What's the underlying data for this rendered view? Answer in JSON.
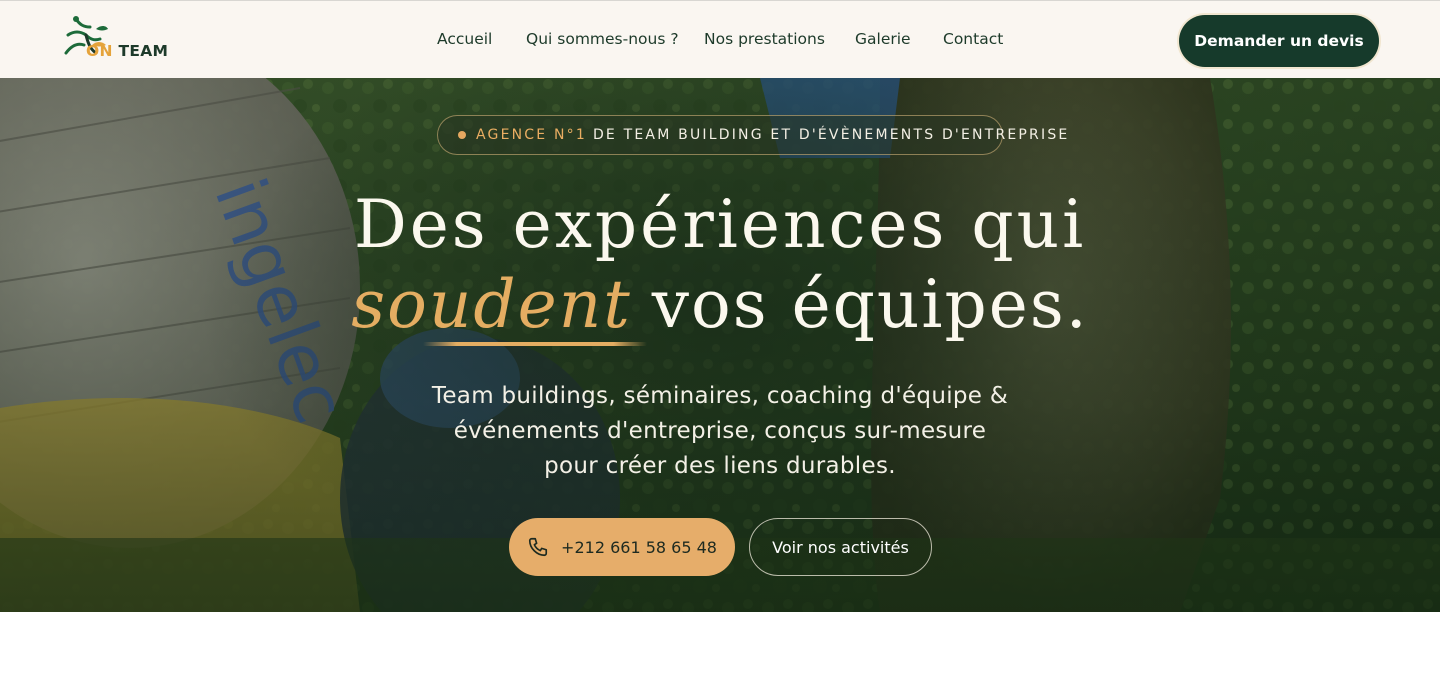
{
  "logo": {
    "text_on": "ON",
    "text_team": " TEAM",
    "icon": "leaf-runner-icon"
  },
  "nav": {
    "items": [
      {
        "label": "Accueil"
      },
      {
        "label": "Qui sommes-nous ?"
      },
      {
        "label": "Nos prestations"
      },
      {
        "label": "Galerie"
      },
      {
        "label": "Contact"
      }
    ]
  },
  "cta": {
    "label": "Demander un devis"
  },
  "hero": {
    "badge_accent": "AGENCE N°1",
    "badge_text": "DE TEAM BUILDING ET D'ÉVÈNEMENTS D'ENTREPRISE",
    "title_line1": "Des expériences qui",
    "title_script": "soudent",
    "title_line2_rest": "vos équipes.",
    "subtitle_line1": "Team buildings, séminaires, coaching d'équipe &",
    "subtitle_line2": "événements d'entreprise, conçus sur-mesure",
    "subtitle_line3": "pour créer des liens durables.",
    "phone_label": "+212 661 58 65 48",
    "activities_label": "Voir nos activités"
  },
  "colors": {
    "brand_dark": "#163a2b",
    "accent": "#e6ad6a",
    "topbar_bg": "#faf6f1"
  }
}
